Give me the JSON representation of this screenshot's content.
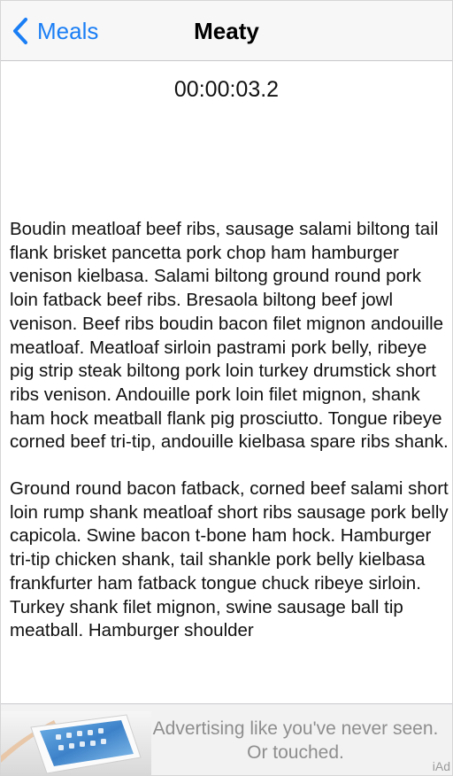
{
  "navbar": {
    "back_label": "Meals",
    "title": "Meaty"
  },
  "timer": {
    "value": "00:00:03.2"
  },
  "content": {
    "paragraphs": [
      "Boudin meatloaf beef ribs, sausage salami biltong tail flank brisket pancetta pork chop ham hamburger venison kielbasa. Salami biltong ground round pork loin fatback beef ribs. Bresaola biltong beef jowl venison. Beef ribs boudin bacon filet mignon andouille meatloaf. Meatloaf sirloin pastrami pork belly, ribeye pig strip steak biltong pork loin turkey drumstick short ribs venison. Andouille pork loin filet mignon, shank ham hock meatball flank pig prosciutto. Tongue ribeye corned beef tri-tip, andouille kielbasa spare ribs shank.",
      "Ground round bacon fatback, corned beef salami short loin rump shank meatloaf short ribs sausage pork belly capicola. Swine bacon t-bone ham hock. Hamburger tri-tip chicken shank, tail shankle pork belly kielbasa frankfurter ham fatback tongue chuck ribeye sirloin. Turkey shank filet mignon, swine sausage ball tip meatball. Hamburger shoulder"
    ]
  },
  "ad": {
    "line1": "Advertising like you've never seen.",
    "line2": "Or touched.",
    "mark": "iAd"
  },
  "colors": {
    "accent": "#1a7ef5"
  }
}
